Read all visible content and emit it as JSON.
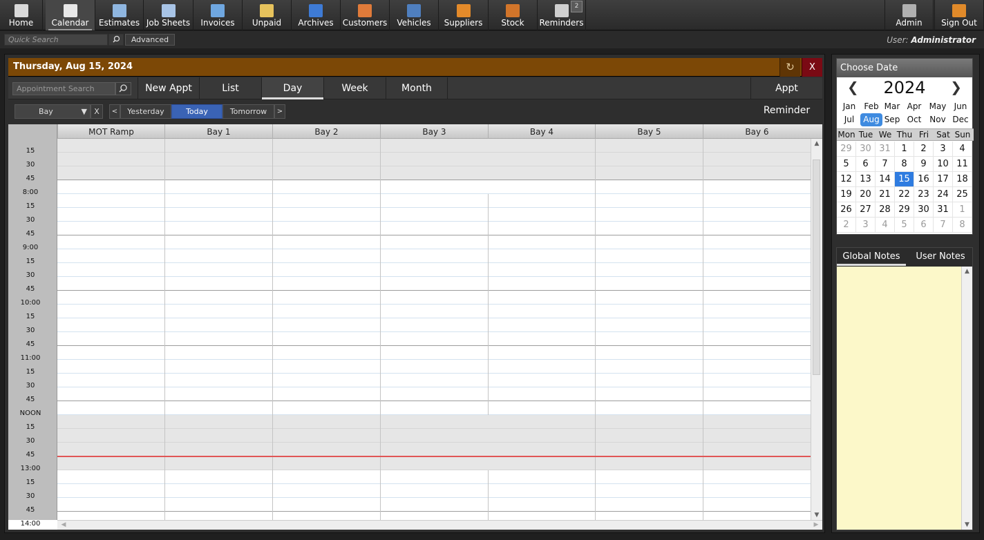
{
  "nav": {
    "items": [
      {
        "label": "Home",
        "icon": "home-icon",
        "color": "#d9d9d9"
      },
      {
        "label": "Calendar",
        "icon": "calendar-icon",
        "color": "#e8e8e8",
        "active": true
      },
      {
        "label": "Estimates",
        "icon": "estimates-icon",
        "color": "#8fb6e0"
      },
      {
        "label": "Job Sheets",
        "icon": "job-sheets-icon",
        "color": "#a8c4e6"
      },
      {
        "label": "Invoices",
        "icon": "invoices-icon",
        "color": "#6fa7e0"
      },
      {
        "label": "Unpaid",
        "icon": "unpaid-icon",
        "color": "#e6c25c"
      },
      {
        "label": "Archives",
        "icon": "archives-icon",
        "color": "#3e7bd6"
      },
      {
        "label": "Customers",
        "icon": "customers-icon",
        "color": "#e07b3a"
      },
      {
        "label": "Vehicles",
        "icon": "vehicles-icon",
        "color": "#4f7fbf"
      },
      {
        "label": "Suppliers",
        "icon": "suppliers-icon",
        "color": "#e38a2a"
      },
      {
        "label": "Stock",
        "icon": "stock-icon",
        "color": "#d2752a"
      },
      {
        "label": "Reminders",
        "icon": "reminders-icon",
        "color": "#cfcfcf",
        "badge": "2"
      }
    ],
    "right": [
      {
        "label": "Admin",
        "icon": "admin-icon",
        "color": "#b0b0b0"
      },
      {
        "label": "Sign Out",
        "icon": "sign-out-icon",
        "color": "#e08a2a"
      }
    ]
  },
  "subbar": {
    "quick_search_placeholder": "Quick Search",
    "advanced_label": "Advanced",
    "user_prefix": "User:",
    "user_name": "Administrator"
  },
  "calendar": {
    "header_title": "Thursday, Aug 15, 2024",
    "refresh_glyph": "↻",
    "close_label": "X",
    "search_placeholder": "Appointment Search",
    "tabs": {
      "new_appt": "New Appt",
      "list": "List",
      "day": "Day",
      "week": "Week",
      "month": "Month"
    },
    "appt_reminder": "Appt Reminder",
    "bay_filter": "Bay",
    "bay_clear": "X",
    "prev": "<",
    "next": ">",
    "yesterday": "Yesterday",
    "today": "Today",
    "tomorrow": "Tomorrow",
    "columns": [
      "MOT Ramp",
      "Bay 1",
      "Bay 2",
      "Bay 3",
      "Bay 4",
      "Bay 5",
      "Bay 6"
    ],
    "time_labels": [
      "15",
      "30",
      "45",
      "8:00",
      "15",
      "30",
      "45",
      "9:00",
      "15",
      "30",
      "45",
      "10:00",
      "15",
      "30",
      "45",
      "11:00",
      "15",
      "30",
      "45",
      "NOON",
      "15",
      "30",
      "45",
      "13:00",
      "15",
      "30",
      "45",
      "14:00"
    ]
  },
  "datepicker": {
    "title": "Choose Date",
    "year": "2024",
    "prev": "❮",
    "next": "❯",
    "months_row1": [
      "Jan",
      "Feb",
      "Mar",
      "Apr",
      "May",
      "Jun"
    ],
    "months_row2": [
      "Jul",
      "Aug",
      "Sep",
      "Oct",
      "Nov",
      "Dec"
    ],
    "selected_month": "Aug",
    "dow": [
      "Mon",
      "Tue",
      "We",
      "Thu",
      "Fri",
      "Sat",
      "Sun"
    ],
    "weeks": [
      [
        "29",
        "30",
        "31",
        "1",
        "2",
        "3",
        "4"
      ],
      [
        "5",
        "6",
        "7",
        "8",
        "9",
        "10",
        "11"
      ],
      [
        "12",
        "13",
        "14",
        "15",
        "16",
        "17",
        "18"
      ],
      [
        "19",
        "20",
        "21",
        "22",
        "23",
        "24",
        "25"
      ],
      [
        "26",
        "27",
        "28",
        "29",
        "30",
        "31",
        "1"
      ],
      [
        "2",
        "3",
        "4",
        "5",
        "6",
        "7",
        "8"
      ]
    ],
    "today": "15"
  },
  "notes": {
    "global_tab": "Global Notes",
    "user_tab": "User Notes"
  }
}
